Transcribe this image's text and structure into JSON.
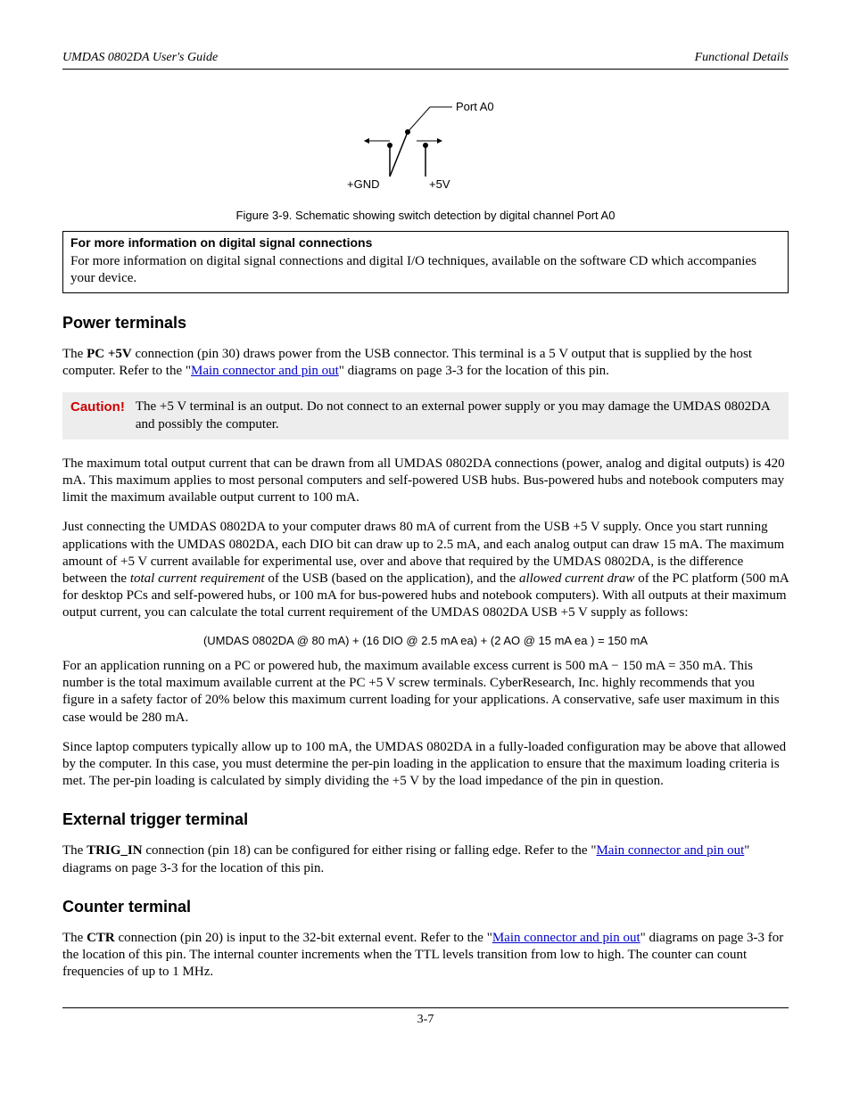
{
  "header": {
    "left": "UMDAS 0802DA User's Guide",
    "right": "Functional Details"
  },
  "schematic": {
    "port_label": "Port A0",
    "gnd_label": "+GND",
    "v5_label": "+5V"
  },
  "figure_caption": "Figure 3-9. Schematic showing switch detection by digital channel Port A0",
  "info_box": {
    "title": "For more information on digital signal connections",
    "body": "For more information on digital signal connections and digital I/O techniques, available on the software CD which accompanies your device."
  },
  "sections": {
    "power": {
      "heading": "Power terminals",
      "p1_a": "The ",
      "p1_bold": "PC +5V",
      "p1_b": " connection (pin 30) draws power from the USB connector. This terminal is a 5 V output that is supplied by the host computer. Refer to the \"",
      "p1_link": "Main connector and pin out",
      "p1_c": "\" diagrams on page 3-3 for the location of this pin.",
      "caution_label": "Caution!",
      "caution_text": "The +5 V terminal is an output. Do not connect to an external power supply or you may damage the UMDAS 0802DA and possibly the computer.",
      "p2": "The maximum total output current that can be drawn from all UMDAS 0802DA connections (power, analog and digital outputs) is 420 mA. This maximum applies to most personal computers and self-powered USB hubs. Bus-powered hubs and notebook computers may limit the maximum available output current to 100 mA.",
      "p3_a": "Just connecting the UMDAS 0802DA to your computer draws 80 mA of current from the USB +5 V supply. Once you start running applications with the UMDAS 0802DA, each DIO bit can draw up to 2.5 mA, and each analog output can draw 15 mA. The maximum amount of +5 V current available for experimental use, over and above that required by the UMDAS 0802DA, is the difference between the ",
      "p3_em1": "total current requirement",
      "p3_b": " of the USB (based on the application), and the ",
      "p3_em2": "allowed current draw",
      "p3_c": " of the PC platform (500 mA for desktop PCs and self-powered hubs, or 100 mA for bus-powered hubs and notebook computers). With all outputs at their maximum output current, you can calculate the total current requirement of the UMDAS 0802DA USB +5 V supply as follows:",
      "formula": "(UMDAS 0802DA @ 80 mA) + (16 DIO @ 2.5 mA ea) + (2 AO @ 15 mA ea ) = 150 mA",
      "p4": "For an application running on a PC or powered hub, the maximum available excess current is 500 mA − 150 mA = 350 mA. This number is the total maximum available current at the PC +5 V screw terminals. CyberResearch, Inc. highly recommends that you figure in a safety factor of 20% below this maximum current loading for your applications. A conservative, safe user maximum in this case would be 280 mA.",
      "p5": "Since laptop computers typically allow up to 100 mA, the UMDAS 0802DA in a fully-loaded configuration may be above that allowed by the computer. In this case, you must determine the per-pin loading in the application to ensure that the maximum loading criteria is met. The per-pin loading is calculated by simply dividing the +5 V by the load impedance of the pin in question."
    },
    "trigger": {
      "heading": "External trigger terminal",
      "p1_a": "The ",
      "p1_bold": "TRIG_IN",
      "p1_b": " connection (pin 18) can be configured for either rising or falling edge. Refer to the \"",
      "p1_link": "Main connector and pin out",
      "p1_c": "\" diagrams on page 3-3 for the location of this pin."
    },
    "counter": {
      "heading": "Counter terminal",
      "p1_a": "The ",
      "p1_bold": "CTR",
      "p1_b": " connection (pin 20) is input to the 32-bit external event. Refer to the \"",
      "p1_link": "Main connector and pin out",
      "p1_c": "\" diagrams on page 3-3 for the location of this pin. The internal counter increments when the TTL levels transition from low to high. The counter can count frequencies of up to 1 MHz."
    }
  },
  "footer": "3-7"
}
